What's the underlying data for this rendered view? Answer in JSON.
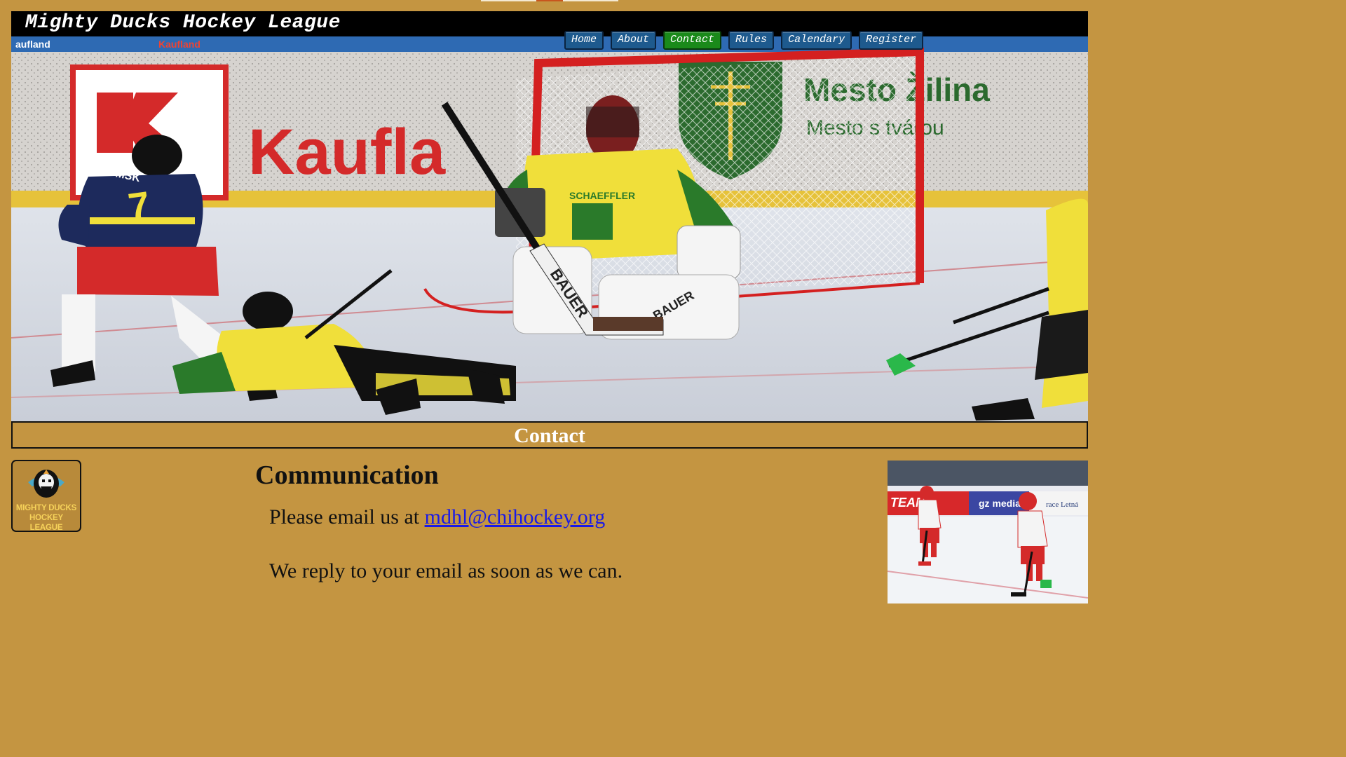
{
  "site": {
    "title": "Mighty Ducks Hockey League"
  },
  "nav": {
    "items": [
      "Home",
      "About",
      "Contact",
      "Rules",
      "Calendary",
      "Register"
    ],
    "active": "Contact"
  },
  "page": {
    "section_title": "Contact",
    "heading": "Communication",
    "email_prefix": "Please email us at ",
    "email": "mdhl@chihockey.org",
    "reply_text": "We reply to your email as soon as we can."
  },
  "logo": {
    "line1": "MIGHTY DUCKS",
    "line2": "HOCKEY LEAGUE"
  },
  "hero_banner": {
    "sponsor_left": "Kaufland",
    "sponsor_right": "Mesto Žilina",
    "sponsor_right_sub": "Mesto s tvárou",
    "player_number": "7",
    "stick_brand": "BAUER"
  },
  "side_banner": {
    "brand_a": "TEAM",
    "brand_b": "gz media"
  },
  "colors": {
    "page_bg": "#c49541",
    "nav_button": "#1e5a8e",
    "nav_active": "#1a8a1a",
    "link": "#1a1ae6"
  }
}
